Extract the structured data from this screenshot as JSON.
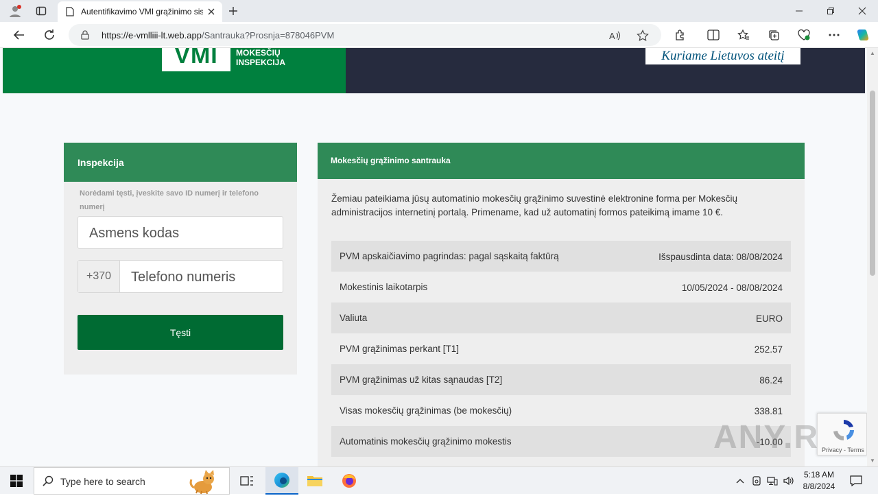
{
  "browser": {
    "tab_title": "Autentifikavimo VMI grąžinimo sis",
    "url_domain": "https://e-vmlliii-lt.web.app",
    "url_path": "/Santrauka?Prosnja=878046PVM"
  },
  "header": {
    "logo_text": "VMI",
    "logo_sub_line1": "MOKESČIŲ",
    "logo_sub_line2": "INSPEKCIJA",
    "slogan": "Kuriame Lietuvos ateitį"
  },
  "login": {
    "title": "Inspekcija",
    "hint": "Norėdami tęsti, įveskite savo ID numerį ir telefono numerį",
    "id_placeholder": "Asmens kodas",
    "phone_prefix": "+370",
    "phone_placeholder": "Telefono numeris",
    "submit_label": "Tęsti"
  },
  "summary": {
    "title": "Mokesčių grąžinimo santrauka",
    "intro": "Žemiau pateikiama jūsų automatinio mokesčių grąžinimo suvestinė elektronine forma per Mokesčių administracijos internetinį portalą. Primename, kad už automatinį formos pateikimą imame 10 €.",
    "rows": [
      {
        "label": "PVM apskaičiavimo pagrindas: pagal sąskaitą faktūrą",
        "value": "Išspausdinta data: 08/08/2024"
      },
      {
        "label": "Mokestinis laikotarpis",
        "value": "10/05/2024 - 08/08/2024"
      },
      {
        "label": "Valiuta",
        "value": "EURO"
      },
      {
        "label": "PVM grąžinimas perkant [T1]",
        "value": "252.57"
      },
      {
        "label": "PVM grąžinimas už kitas sąnaudas [T2]",
        "value": "86.24"
      },
      {
        "label": "Visas mokesčių grąžinimas (be mokesčių)",
        "value": "338.81"
      },
      {
        "label": "Automatinis mokesčių grąžinimo mokestis",
        "value": "-10.00"
      }
    ]
  },
  "recaptcha": {
    "text": "Privacy - Terms"
  },
  "watermark": "ANY.RUN",
  "taskbar": {
    "search_placeholder": "Type here to search",
    "time": "5:18 AM",
    "date": "8/8/2024"
  },
  "colors": {
    "brand_green": "#00803e",
    "card_green": "#2f8a57",
    "button_green": "#006b33",
    "banner_dark": "#262b3e"
  }
}
